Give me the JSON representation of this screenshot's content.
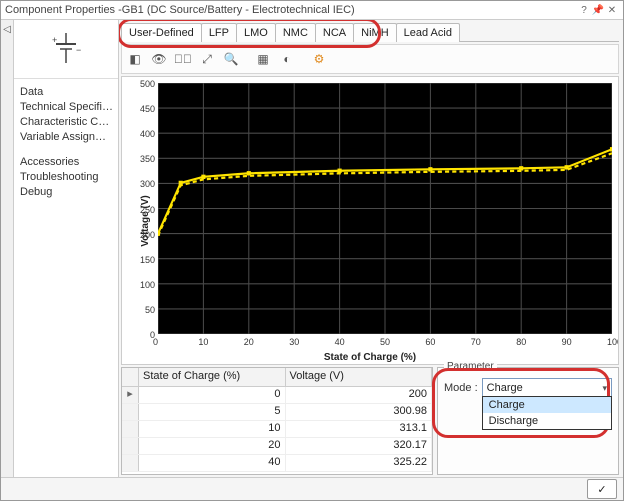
{
  "window": {
    "title": "Component Properties -GB1 (DC Source/Battery - Electrotechnical IEC)"
  },
  "win_buttons": {
    "help": "?",
    "pin": "📌",
    "close": "✕"
  },
  "sidebar": {
    "items": [
      "Data",
      "Technical Specifications",
      "Characteristic Curves",
      "Variable Assignment"
    ],
    "items2": [
      "Accessories",
      "Troubleshooting",
      "Debug"
    ]
  },
  "tabs": [
    "User-Defined",
    "LFP",
    "LMO",
    "NMC",
    "NCA",
    "NiMH",
    "Lead Acid"
  ],
  "chart": {
    "ylabel": "Voltage (V)",
    "xlabel": "State of Charge (%)",
    "x_ticks": [
      0,
      10,
      20,
      30,
      40,
      50,
      60,
      70,
      80,
      90,
      100
    ],
    "y_ticks": [
      0,
      50,
      100,
      150,
      200,
      250,
      300,
      350,
      400,
      450,
      500
    ]
  },
  "chart_data": {
    "type": "line",
    "xlabel": "State of Charge (%)",
    "ylabel": "Voltage (V)",
    "xlim": [
      0,
      100
    ],
    "ylim": [
      0,
      500
    ],
    "series": [
      {
        "name": "Charge",
        "style": "solid",
        "x": [
          0,
          5,
          10,
          20,
          40,
          60,
          80,
          90,
          100
        ],
        "y": [
          200,
          300.98,
          313.1,
          320.17,
          325.22,
          328,
          330,
          332,
          368
        ]
      },
      {
        "name": "Discharge",
        "style": "dashed",
        "x": [
          0,
          5,
          10,
          20,
          40,
          60,
          80,
          90,
          100
        ],
        "y": [
          196,
          296,
          308,
          315,
          320,
          323,
          325,
          327,
          360
        ]
      }
    ]
  },
  "table": {
    "headers": [
      "State of Charge (%)",
      "Voltage (V)"
    ],
    "rows": [
      {
        "soc": "0",
        "v": "200"
      },
      {
        "soc": "5",
        "v": "300.98"
      },
      {
        "soc": "10",
        "v": "313.1"
      },
      {
        "soc": "20",
        "v": "320.17"
      },
      {
        "soc": "40",
        "v": "325.22"
      }
    ]
  },
  "param": {
    "group": "Parameter",
    "mode_label": "Mode :",
    "mode_value": "Charge",
    "mode_options": [
      "Charge",
      "Discharge"
    ]
  },
  "toolbar_icons": [
    "◧",
    "👁",
    "�⃞",
    "⤢",
    "🔍",
    "▦",
    "◐",
    "⚙"
  ],
  "checkmark": "✓"
}
